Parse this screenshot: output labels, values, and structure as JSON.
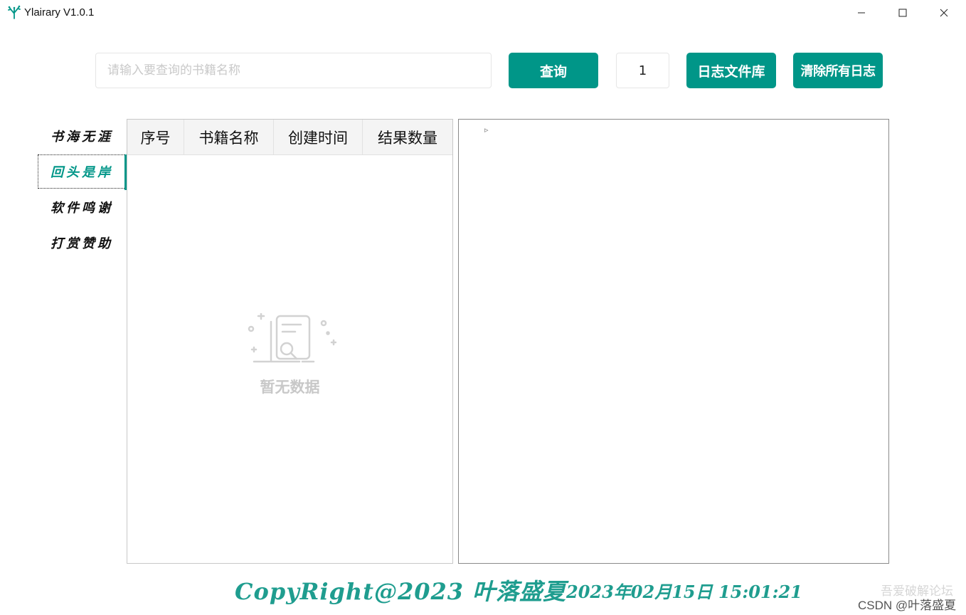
{
  "window": {
    "title": "Ylairary V1.0.1",
    "app_icon": "tree-logo-icon",
    "controls": [
      "minimize-icon",
      "maximize-icon",
      "close-icon"
    ]
  },
  "toolbar": {
    "search_placeholder": "请输入要查询的书籍名称",
    "search_value": "",
    "query_label": "查询",
    "page_number": "1",
    "log_library_label": "日志文件库",
    "clear_logs_label": "清除所有日志"
  },
  "nav": {
    "items": [
      {
        "label": "书海无涯"
      },
      {
        "label": "回头是岸"
      },
      {
        "label": "软件鸣谢"
      },
      {
        "label": "打赏赞助"
      }
    ],
    "active_index": 1
  },
  "table": {
    "columns": [
      "序号",
      "书籍名称",
      "创建时间",
      "结果数量"
    ],
    "rows": [],
    "empty_text": "暂无数据",
    "empty_icon": "empty-document-search-icon"
  },
  "log_panel": {
    "caret": "▹"
  },
  "footer": {
    "copyright": "CopyRight@2023 叶落盛夏",
    "datetime": "2023年02月15日 15:01:21"
  },
  "watermark": {
    "line1": "吾爱破解论坛",
    "line2": "CSDN @叶落盛夏"
  },
  "colors": {
    "accent": "#009688",
    "footer_text": "#1f9d8f",
    "empty_gray": "#c8c8c8"
  }
}
